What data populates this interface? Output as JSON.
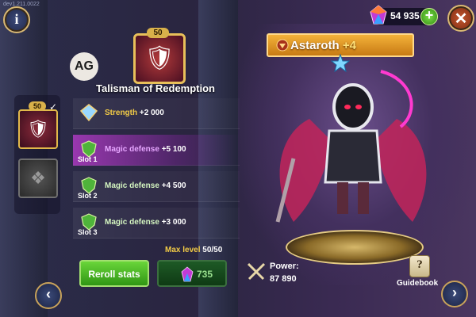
{
  "version": "dev1.211.0022",
  "top": {
    "gems": "54 935",
    "plus_label": "+",
    "close_label": "✕",
    "info_label": "i"
  },
  "slots": {
    "active_level": "50",
    "checkmark": "✓"
  },
  "logo_text": "AG",
  "item": {
    "level": "50",
    "title": "Talisman of Redemption"
  },
  "stats": [
    {
      "name": "Strength",
      "value": "+2 000",
      "slot": ""
    },
    {
      "name": "Magic defense",
      "value": "+5 100",
      "slot": "Slot 1"
    },
    {
      "name": "Magic defense",
      "value": "+4 500",
      "slot": "Slot 2"
    },
    {
      "name": "Magic defense",
      "value": "+3 000",
      "slot": "Slot 3"
    }
  ],
  "max_level": {
    "label": "Max level",
    "value": "50/50"
  },
  "reroll": {
    "label": "Reroll stats",
    "cost": "735"
  },
  "hero": {
    "name": "Astaroth",
    "plus": "+4"
  },
  "power": {
    "label": "Power:",
    "value": "87 890"
  },
  "guidebook": {
    "label": "Guidebook",
    "icon_glyph": "?"
  },
  "nav": {
    "left": "‹",
    "right": "›"
  },
  "colors": {
    "accent_gold": "#f2cb46",
    "active_row": "#be3cd2",
    "button_green": "#4bbf28"
  }
}
